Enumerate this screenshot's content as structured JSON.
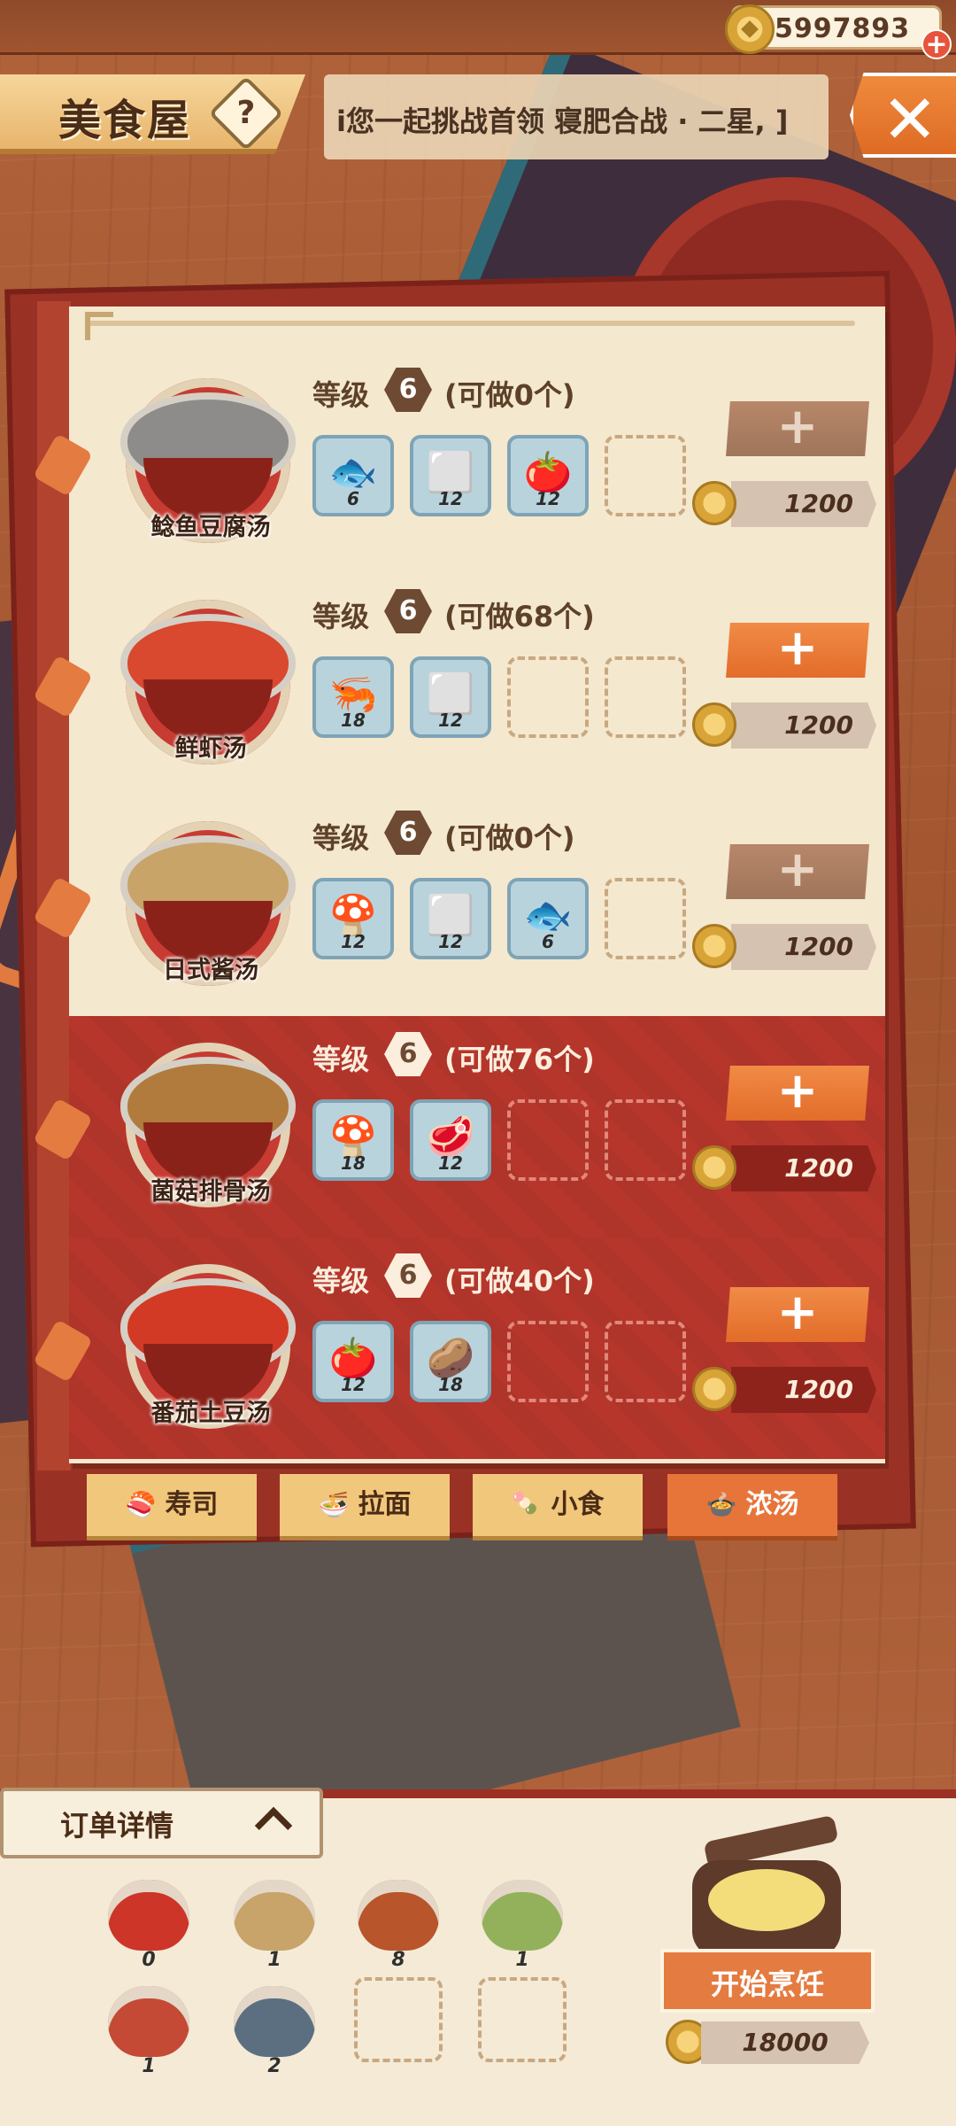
{
  "header": {
    "coins": "5997893",
    "title": "美食屋",
    "help_symbol": "?",
    "marquee": "i您一起挑战首领 寝肥合战 · 二星, ]",
    "close_symbol": "✕",
    "coin_plus_symbol": "+"
  },
  "recipes": [
    {
      "name": "鲶鱼豆腐汤",
      "level_label": "等级",
      "level": "6",
      "can_make": "(可做0个)",
      "add_symbol": "+",
      "price": "1200",
      "ingredients": [
        {
          "icon": "catfish-icon",
          "glyph": "🐟",
          "qty": "6"
        },
        {
          "icon": "tofu-icon",
          "glyph": "⬜",
          "qty": "12"
        },
        {
          "icon": "tomato-icon",
          "glyph": "🍅",
          "qty": "12"
        }
      ]
    },
    {
      "name": "鲜虾汤",
      "level_label": "等级",
      "level": "6",
      "can_make": "(可做68个)",
      "add_symbol": "+",
      "price": "1200",
      "ingredients": [
        {
          "icon": "shrimp-icon",
          "glyph": "🦐",
          "qty": "18"
        },
        {
          "icon": "tofu-icon",
          "glyph": "⬜",
          "qty": "12"
        }
      ]
    },
    {
      "name": "日式酱汤",
      "level_label": "等级",
      "level": "6",
      "can_make": "(可做0个)",
      "add_symbol": "+",
      "price": "1200",
      "ingredients": [
        {
          "icon": "mushroom-icon",
          "glyph": "🍄",
          "qty": "12"
        },
        {
          "icon": "tofu-icon",
          "glyph": "⬜",
          "qty": "12"
        },
        {
          "icon": "catfish-icon",
          "glyph": "🐟",
          "qty": "6"
        }
      ]
    },
    {
      "name": "菌菇排骨汤",
      "level_label": "等级",
      "level": "6",
      "can_make": "(可做76个)",
      "add_symbol": "+",
      "price": "1200",
      "ingredients": [
        {
          "icon": "mushroom-icon",
          "glyph": "🍄",
          "qty": "18"
        },
        {
          "icon": "pork-rib-icon",
          "glyph": "🥩",
          "qty": "12"
        }
      ]
    },
    {
      "name": "番茄土豆汤",
      "level_label": "等级",
      "level": "6",
      "can_make": "(可做40个)",
      "add_symbol": "+",
      "price": "1200",
      "ingredients": [
        {
          "icon": "tomato-icon",
          "glyph": "🍅",
          "qty": "12"
        },
        {
          "icon": "potato-icon",
          "glyph": "🥔",
          "qty": "18"
        }
      ]
    }
  ],
  "tabs": [
    {
      "label": "寿司",
      "icon": "sushi-icon",
      "glyph": "🍣"
    },
    {
      "label": "拉面",
      "icon": "ramen-icon",
      "glyph": "🍜"
    },
    {
      "label": "小食",
      "icon": "snack-icon",
      "glyph": "🍡"
    },
    {
      "label": "浓汤",
      "icon": "soup-icon",
      "glyph": "🍲"
    }
  ],
  "order": {
    "title": "订单详情",
    "items": [
      {
        "icon": "tomato-soup-icon",
        "count": "0"
      },
      {
        "icon": "oden-icon",
        "count": "1"
      },
      {
        "icon": "seafood-soup-icon",
        "count": "8"
      },
      {
        "icon": "salad-bowl-icon",
        "count": "1"
      },
      {
        "icon": "cold-noodle-icon",
        "count": "1"
      },
      {
        "icon": "eel-rice-icon",
        "count": "2"
      }
    ],
    "cook_label": "开始烹饪",
    "cook_price": "18000"
  },
  "colors": {
    "accent": "#e47b40",
    "row_light": "#f4e8cf",
    "row_red": "#b6362c"
  }
}
